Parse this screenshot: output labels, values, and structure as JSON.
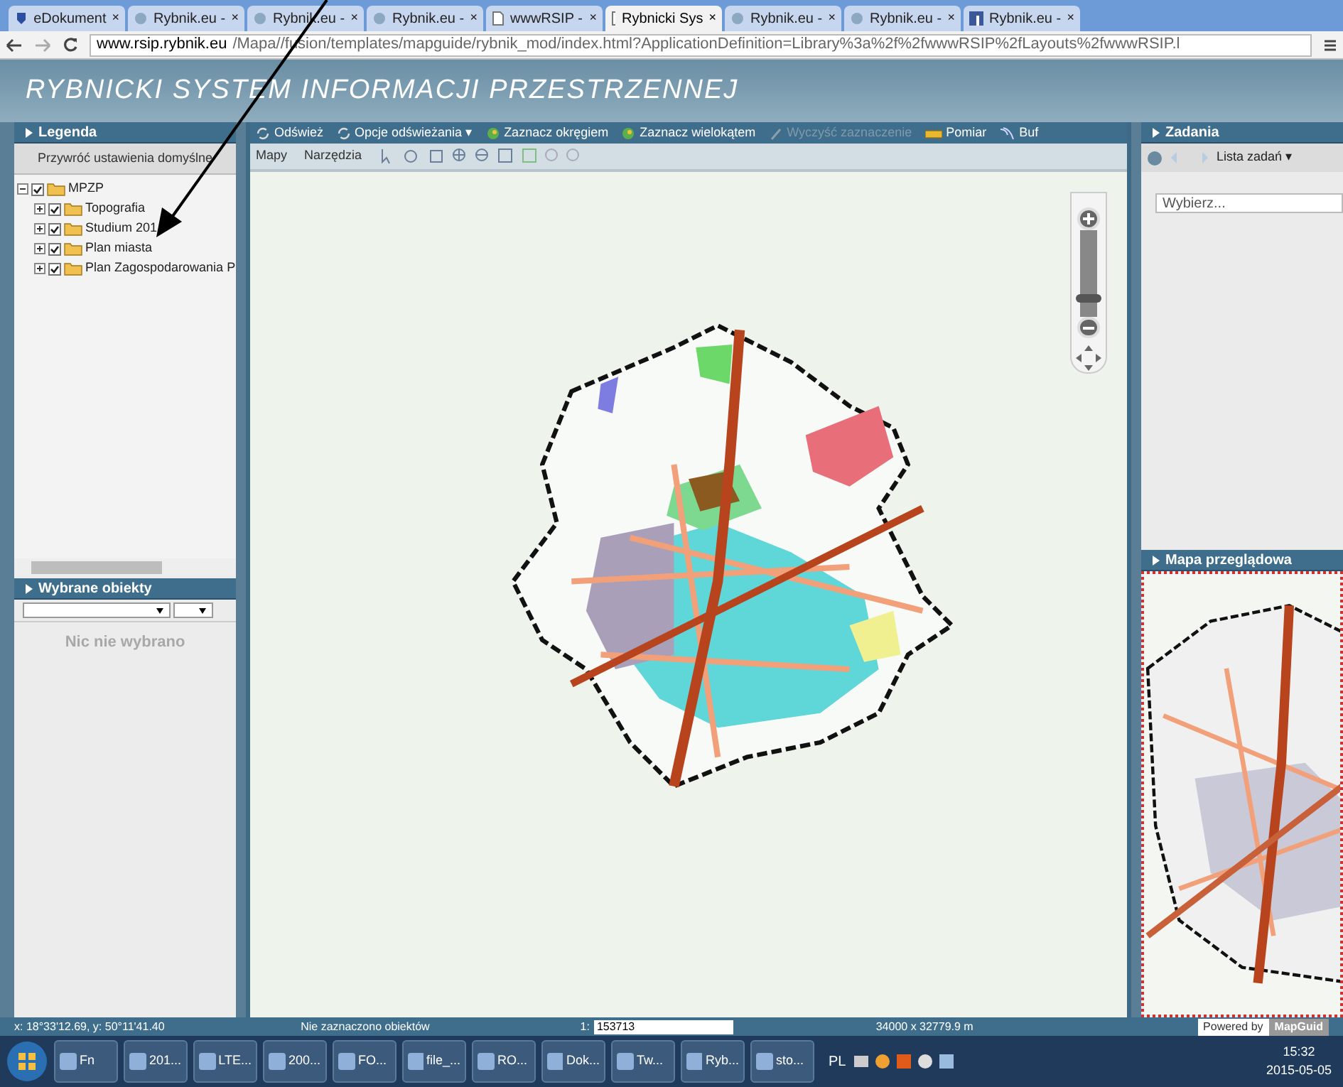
{
  "browser": {
    "tabs": [
      {
        "label": "eDokument",
        "selected": false,
        "kind": "doc",
        "close": "×"
      },
      {
        "label": "Rybnik.eu - ",
        "selected": false,
        "kind": "site",
        "close": "×"
      },
      {
        "label": "Rybnik.eu - ",
        "selected": false,
        "kind": "site",
        "close": "×"
      },
      {
        "label": "Rybnik.eu - ",
        "selected": false,
        "kind": "site",
        "close": "×"
      },
      {
        "label": "wwwRSIP - ",
        "selected": false,
        "kind": "page",
        "close": "×"
      },
      {
        "label": "Rybnicki Sys",
        "selected": true,
        "kind": "page",
        "close": "×"
      },
      {
        "label": "Rybnik.eu - ",
        "selected": false,
        "kind": "site",
        "close": "×"
      },
      {
        "label": "Rybnik.eu - ",
        "selected": false,
        "kind": "site",
        "close": "×"
      },
      {
        "label": "Rybnik.eu - ",
        "selected": false,
        "kind": "fb",
        "close": "×"
      }
    ],
    "url_host": "www.rsip.rybnik.eu",
    "url_path": "/Mapa//fusion/templates/mapguide/rybnik_mod/index.html?ApplicationDefinition=Library%3a%2f%2fwwwRSIP%2fLayouts%2fwwwRSIP.l"
  },
  "app_title": "RYBNICKI SYSTEM INFORMACJI PRZESTRZENNEJ",
  "legend": {
    "title": "Legenda",
    "reset_button": "Przywróć ustawienia domyślne",
    "tree": [
      {
        "label": "MPZP",
        "checked": true,
        "expanded": true,
        "children": [
          {
            "label": "Topografia",
            "checked": true,
            "expanded": false
          },
          {
            "label": "Studium 201",
            "checked": true,
            "expanded": false
          },
          {
            "label": "Plan miasta",
            "checked": true,
            "expanded": false
          },
          {
            "label": "Plan Zagospodarowania P",
            "checked": true,
            "expanded": false
          }
        ]
      }
    ]
  },
  "selected_objects": {
    "title": "Wybrane obiekty",
    "empty_text": "Nic nie wybrano"
  },
  "toolbar": [
    {
      "label": "Odśwież",
      "kind": "refresh",
      "disabled": false
    },
    {
      "label": "Opcje odświeżania ▾",
      "kind": "refresh",
      "disabled": false
    },
    {
      "label": "Zaznacz okręgiem",
      "kind": "select",
      "disabled": false
    },
    {
      "label": "Zaznacz wielokątem",
      "kind": "select",
      "disabled": false
    },
    {
      "label": "Wyczyść zaznaczenie",
      "kind": "clear",
      "disabled": true
    },
    {
      "label": "Pomiar",
      "kind": "measure",
      "disabled": false
    },
    {
      "label": "Buf",
      "kind": "buffer",
      "disabled": false
    }
  ],
  "menus": [
    "Mapy",
    "Narzędzia"
  ],
  "zoom_slider": {
    "level": 0.2
  },
  "tasks": {
    "title": "Zadania",
    "task_list": "Lista zadań ▾",
    "select_placeholder": "Wybierz..."
  },
  "overview": {
    "title": "Mapa przeglądowa"
  },
  "status_bar": {
    "coords": "x: 18°33'12.69, y: 50°11'41.40",
    "selection": "Nie zaznaczono obiektów",
    "scale_label": "1:",
    "scale_value": "153713",
    "extent": "34000 x 32779.9 m",
    "powered_by": "Powered by",
    "brand": "MapGuid"
  },
  "taskbar": {
    "items": [
      "Fn",
      "201...",
      "LTE...",
      "200...",
      "FO...",
      "file_...",
      "RO...",
      "Dok...",
      "Tw...",
      "Ryb...",
      "sto..."
    ],
    "language": "PL",
    "time": "15:32",
    "date": "2015-05-05"
  }
}
